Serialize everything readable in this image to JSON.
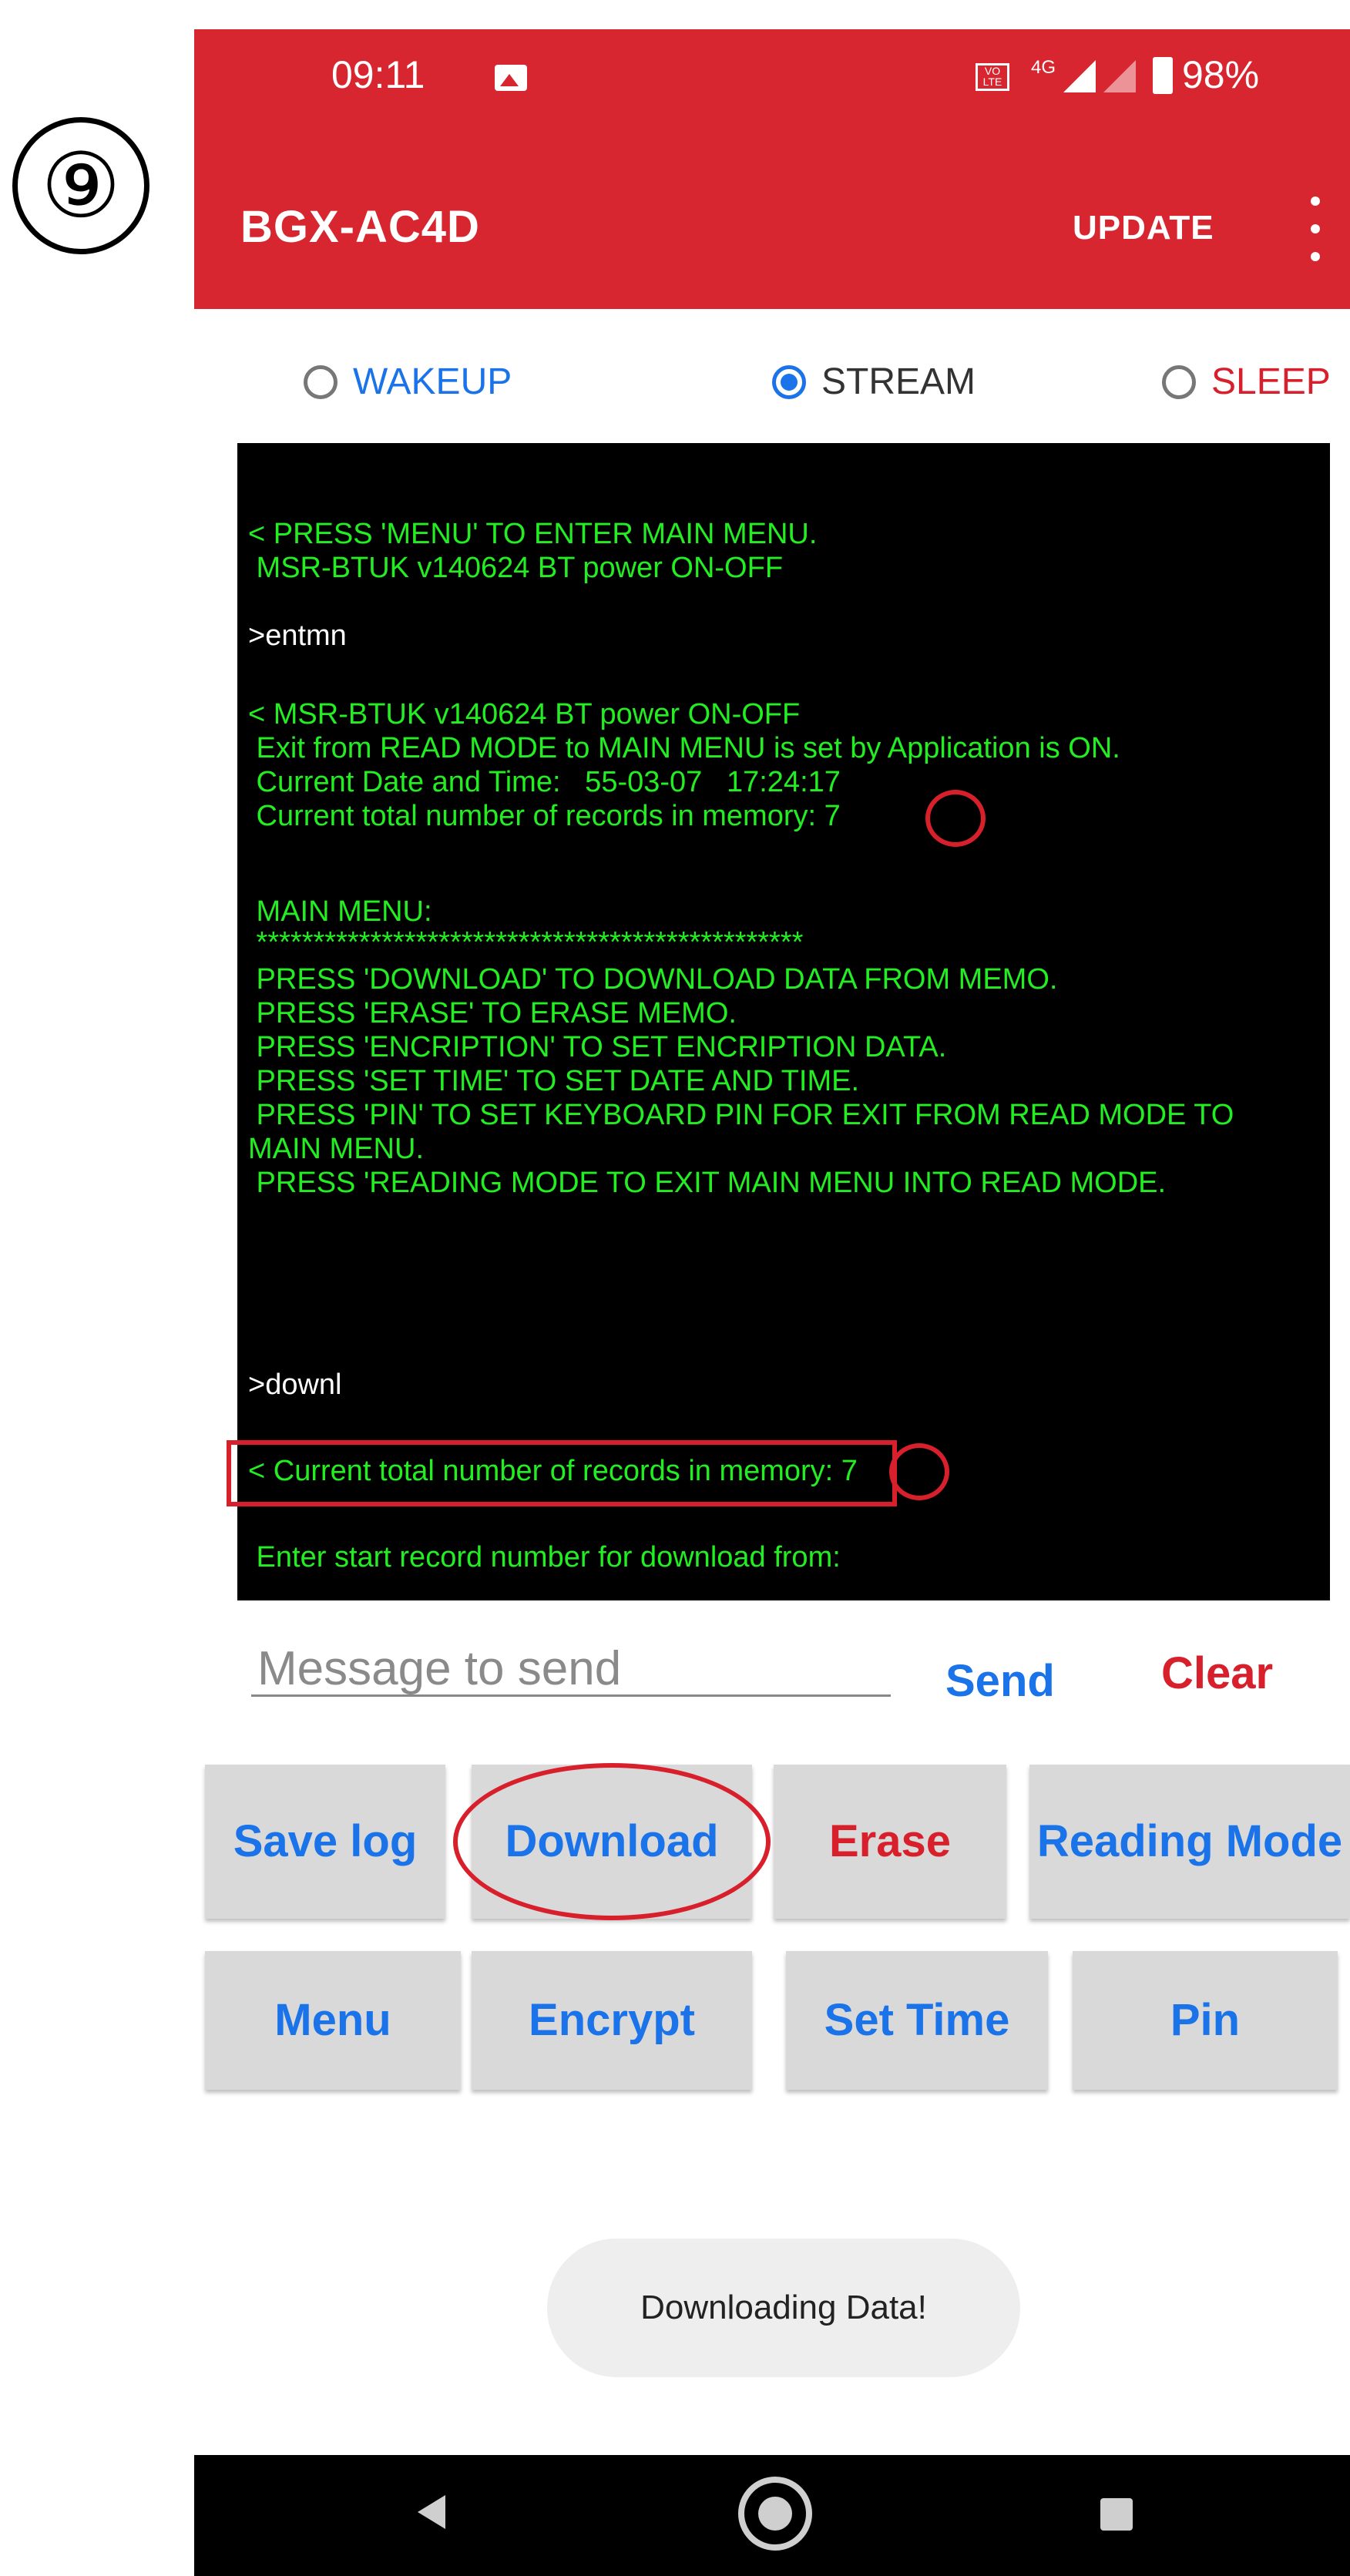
{
  "step_marker": "⑨",
  "status_bar": {
    "time": "09:11",
    "volte": "VO LTE",
    "network": "4G",
    "battery": "98%",
    "icons": [
      "image-icon",
      "volte-icon",
      "signal-icon",
      "battery-icon"
    ]
  },
  "app_bar": {
    "title": "BGX-AC4D",
    "update_label": "UPDATE",
    "menu_icon": "overflow-menu-icon"
  },
  "modes": [
    {
      "label": "WAKEUP",
      "selected": false,
      "color": "#1a73e8"
    },
    {
      "label": "STREAM",
      "selected": true,
      "color": "#333333"
    },
    {
      "label": "SLEEP",
      "selected": false,
      "color": "#d8202c"
    }
  ],
  "terminal": {
    "lines": [
      "< PRESS 'MENU' TO ENTER MAIN MENU.",
      " MSR-BTUK v140624 BT power ON-OFF",
      ">entmn",
      "< MSR-BTUK v140624 BT power ON-OFF",
      " Exit from READ MODE to MAIN MENU is set by Application is ON.",
      " Current Date and Time:   55-03-07   17:24:17",
      " Current total number of records in memory: 7",
      " MAIN MENU:",
      " ************************************************",
      " PRESS 'DOWNLOAD' TO DOWNLOAD DATA FROM MEMO.",
      " PRESS 'ERASE' TO ERASE MEMO.",
      " PRESS 'ENCRIPTION' TO SET ENCRIPTION DATA.",
      " PRESS 'SET TIME' TO SET DATE AND TIME.",
      " PRESS 'PIN' TO SET KEYBOARD PIN FOR EXIT FROM READ MODE TO",
      "MAIN MENU.",
      " PRESS 'READING MODE TO EXIT MAIN MENU INTO READ MODE.",
      ">downl",
      "< Current total number of records in memory: 7",
      " Enter start record number for download from:"
    ]
  },
  "message": {
    "placeholder": "Message to send",
    "send_label": "Send",
    "clear_label": "Clear"
  },
  "buttons": {
    "row1": [
      "Save log",
      "Download",
      "Erase",
      "Reading Mode"
    ],
    "row2": [
      "Menu",
      "Encrypt",
      "Set Time",
      "Pin"
    ]
  },
  "toast": "Downloading Data!",
  "annotation_color": "#d8202c",
  "accent_color": "#1a73e8",
  "app_bar_color": "#d7262f",
  "terminal_text_color": "#22ee22"
}
